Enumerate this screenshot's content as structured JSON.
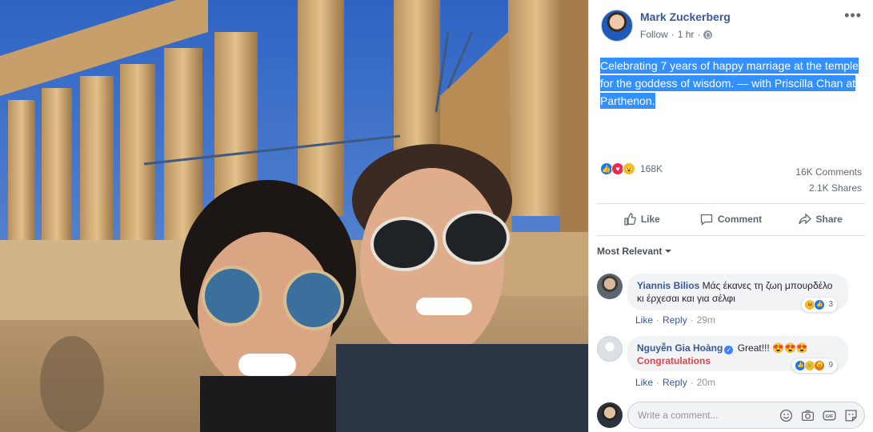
{
  "post": {
    "author_name": "Mark Zuckerberg",
    "follow_label": "Follow",
    "separator": "·",
    "time": "1 hr",
    "more_icon": "more-options-icon",
    "caption": "Celebrating 7 years of happy marriage at the temple for the goddess of wisdom. — with Priscilla Chan at Parthenon.",
    "reaction_icons": [
      "like-icon",
      "love-icon",
      "wow-icon"
    ],
    "reaction_count": "168K",
    "comments_count": "16K Comments",
    "shares_count": "2.1K Shares"
  },
  "actions": {
    "like": "Like",
    "comment": "Comment",
    "share": "Share"
  },
  "comments_section": {
    "sort_label": "Most Relevant",
    "comments": [
      {
        "author": "Yiannis Bilios",
        "text": "Μάς έκανες τη ζωη μπουρδέλο κι έρχεσαι και για σέλφι",
        "reactions_count": "3",
        "like": "Like",
        "reply": "Reply",
        "time": "29m"
      },
      {
        "author": "Nguyễn Gia Hoàng",
        "text": "Great!!! 😍😍😍",
        "secondary_text": "Congratulations",
        "reactions_count": "9",
        "like": "Like",
        "reply": "Reply",
        "time": "20m"
      }
    ],
    "composer_placeholder": "Write a comment..."
  },
  "colors": {
    "link_blue": "#385898",
    "highlight": "#3390ff",
    "congrats_red": "#e4434b",
    "sky": "#3d6fbe"
  }
}
